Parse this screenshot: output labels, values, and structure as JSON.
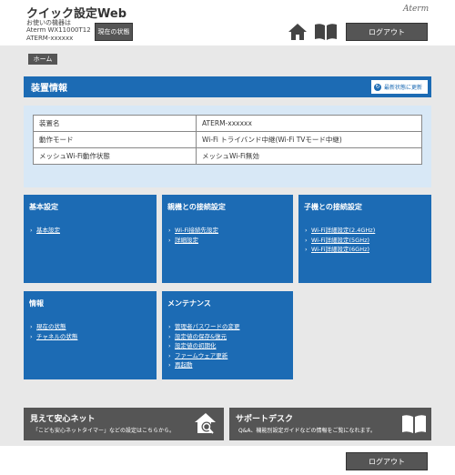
{
  "header": {
    "title": "クイック設定Web",
    "device_line1": "お使いの機器は",
    "device_line2": "Aterm WX11000T12",
    "device_line3": "ATERM-xxxxxx",
    "status_button": "現在の状態",
    "brand": "Aterm",
    "logout": "ログアウト",
    "icons": {
      "home": "home-icon",
      "manual": "book-icon"
    }
  },
  "breadcrumb": {
    "home": "ホーム"
  },
  "device_info": {
    "title": "装置情報",
    "refresh": "最新状態に更新",
    "rows": [
      {
        "label": "装置名",
        "value": "ATERM-xxxxxx"
      },
      {
        "label": "動作モード",
        "value": "Wi-Fi トライバンド中継(Wi-Fi TVモード中継)"
      },
      {
        "label": "メッシュWi-Fi動作状態",
        "value": "メッシュWi-Fi無効"
      }
    ]
  },
  "cards": {
    "basic": {
      "title": "基本設定",
      "links": [
        "基本設定"
      ]
    },
    "parent": {
      "title": "親機との接続設定",
      "links": [
        "Wi-Fi接続先設定",
        "詳細設定"
      ]
    },
    "child": {
      "title": "子機との接続設定",
      "links": [
        "Wi-Fi詳細設定(2.4GHz)",
        "Wi-Fi詳細設定(5GHz)",
        "Wi-Fi詳細設定(6GHz)"
      ]
    },
    "info": {
      "title": "情報",
      "links": [
        "現在の状態",
        "チャネルの状態"
      ]
    },
    "maint": {
      "title": "メンテナンス",
      "links": [
        "管理者パスワードの変更",
        "設定値の保存&復元",
        "設定値の初期化",
        "ファームウェア更新",
        "再起動"
      ]
    }
  },
  "bottom": {
    "safety": {
      "title": "見えて安心ネット",
      "desc": "「こども安心ネットタイマー」などの設定はこちらから。"
    },
    "support": {
      "title": "サポートデスク",
      "desc": "Q&A、機能別設定ガイドなどの情報をご覧になれます。"
    }
  },
  "footer": {
    "logout": "ログアウト"
  },
  "colors": {
    "accent": "#1c6bb4",
    "dark_button": "#555555",
    "panel": "#d8e8f6"
  }
}
